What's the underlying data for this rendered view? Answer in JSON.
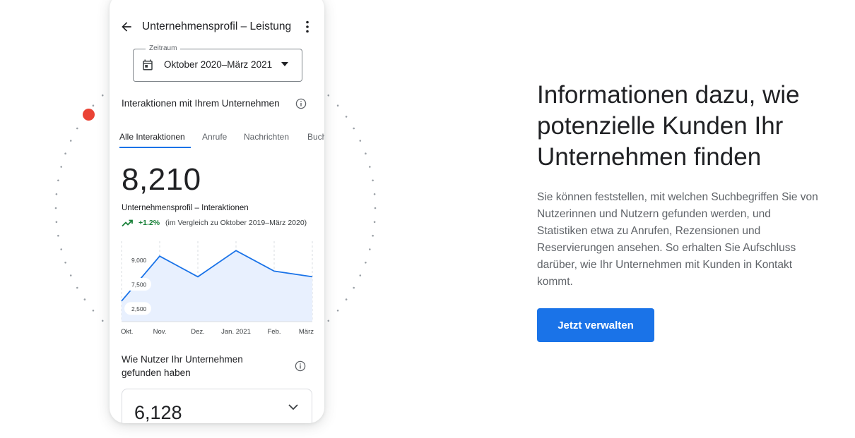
{
  "phone": {
    "title": "Unternehmensprofil – Leistung",
    "range_label": "Zeitraum",
    "range_value": "Oktober 2020–März 2021",
    "section_title": "Interaktionen mit Ihrem Unternehmen",
    "tabs": [
      {
        "label": "Alle Interaktionen",
        "active": true
      },
      {
        "label": "Anrufe",
        "active": false
      },
      {
        "label": "Nachrichten",
        "active": false
      },
      {
        "label": "Buch",
        "active": false
      }
    ],
    "total": "8,210",
    "metric_label": "Unternehmensprofil – Interaktionen",
    "trend_value": "+1.2%",
    "trend_compare": "(im Vergleich zu Oktober 2019–März 2020)",
    "found_title": "Wie Nutzer Ihr Unternehmen gefunden haben",
    "found_total": "6,128"
  },
  "chart_data": {
    "type": "area",
    "categories": [
      "Okt.",
      "Nov.",
      "Dez.",
      "Jan. 2021",
      "Feb.",
      "März"
    ],
    "values": [
      6200,
      8600,
      7500,
      8900,
      7800,
      7500
    ],
    "y_tick_labels": [
      "9,000",
      "7,500",
      "2,500"
    ],
    "y_tick_values": [
      8400,
      7100,
      5800
    ],
    "ylim": [
      5100,
      9400
    ],
    "grid": "vertical dashed",
    "line_color": "#1a73e8",
    "fill_color": "#e8f0fe"
  },
  "promo": {
    "heading": "Informationen dazu, wie potenzielle Kunden Ihr Unternehmen finden",
    "body": "Sie können feststellen, mit welchen Suchbegriffen Sie von Nutzerinnen und Nutzern gefunden werden, und Statistiken etwa zu Anrufen, Rezensionen und Reservierungen ansehen. So erhalten Sie Aufschluss darüber, wie Ihr Unternehmen mit Kunden in Kontakt kommt.",
    "cta_label": "Jetzt verwalten"
  },
  "colors": {
    "accent": "#1a73e8",
    "positive": "#188038",
    "decor_dot": "#ea4335"
  }
}
